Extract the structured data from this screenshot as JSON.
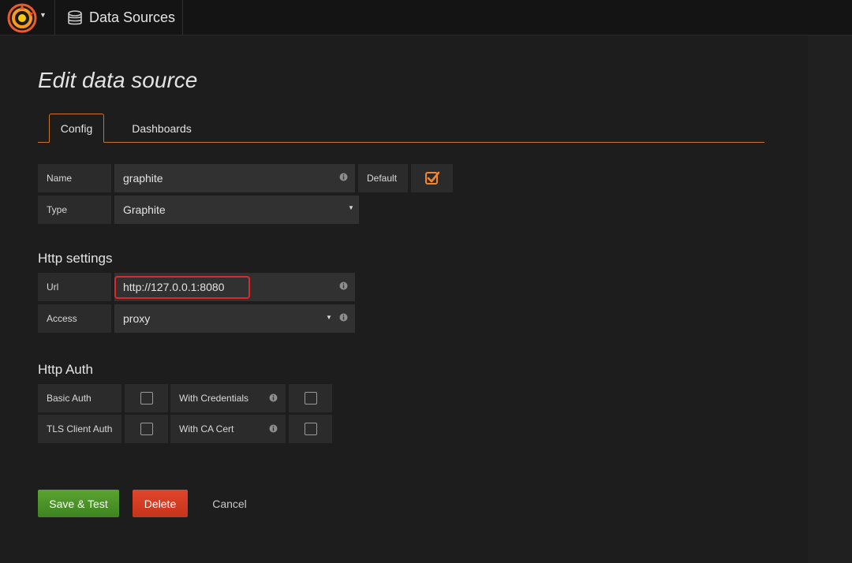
{
  "topbar": {
    "breadcrumb": "Data Sources"
  },
  "page": {
    "title": "Edit data source"
  },
  "tabs": [
    {
      "label": "Config",
      "active": true
    },
    {
      "label": "Dashboards",
      "active": false
    }
  ],
  "form": {
    "name_label": "Name",
    "name_value": "graphite",
    "default_label": "Default",
    "default_checked": true,
    "type_label": "Type",
    "type_value": "Graphite"
  },
  "http_settings": {
    "title": "Http settings",
    "url_label": "Url",
    "url_value": "http://127.0.0.1:8080",
    "access_label": "Access",
    "access_value": "proxy"
  },
  "http_auth": {
    "title": "Http Auth",
    "basic_auth_label": "Basic Auth",
    "basic_auth_checked": false,
    "with_credentials_label": "With Credentials",
    "with_credentials_checked": false,
    "tls_client_auth_label": "TLS Client Auth",
    "tls_client_auth_checked": false,
    "with_ca_cert_label": "With CA Cert",
    "with_ca_cert_checked": false
  },
  "actions": {
    "save_label": "Save & Test",
    "delete_label": "Delete",
    "cancel_label": "Cancel"
  },
  "colors": {
    "accent_orange": "#c5752c",
    "checkbox_orange": "#f2852f",
    "save_green": "#4e9a2a",
    "delete_red": "#d63d21",
    "highlight_red": "#e0282a"
  }
}
